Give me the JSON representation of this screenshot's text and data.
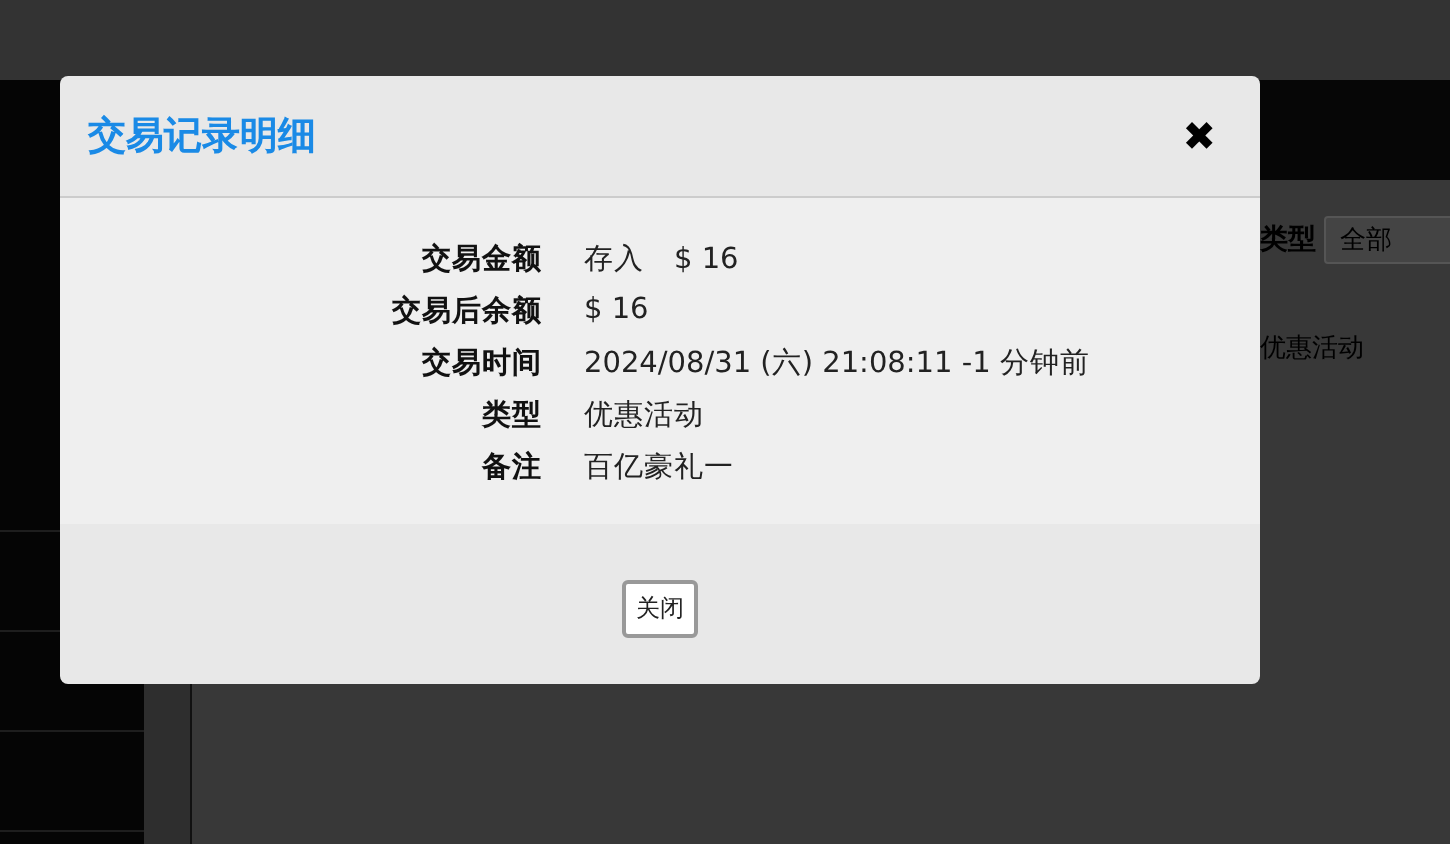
{
  "background": {
    "filter_label": "类型",
    "filter_select": "全部",
    "row_type": "优惠活动"
  },
  "dialog": {
    "title": "交易记录明细",
    "close_icon": "✖",
    "fields": [
      {
        "label": "交易金额",
        "value": "存入　$ 16"
      },
      {
        "label": "交易后余额",
        "value": "$ 16"
      },
      {
        "label": "交易时间",
        "value": "2024/08/31 (六) 21:08:11 -1 分钟前"
      },
      {
        "label": "类型",
        "value": "优惠活动"
      },
      {
        "label": "备注",
        "value": "百亿豪礼一"
      }
    ],
    "button": "关闭"
  }
}
